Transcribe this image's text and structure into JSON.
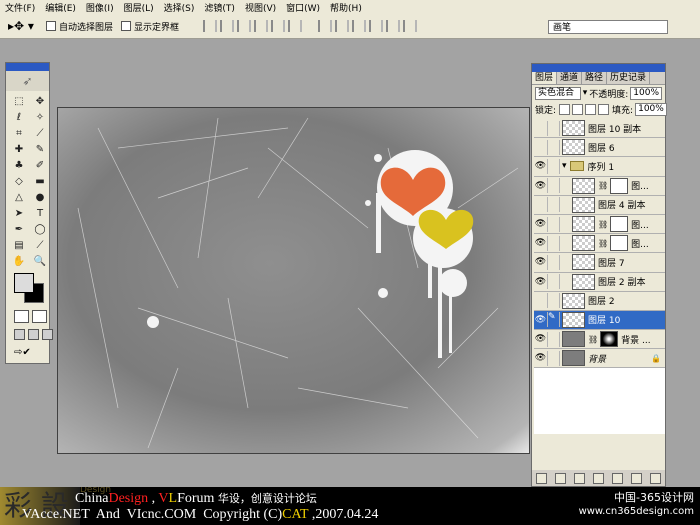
{
  "menu": [
    "文件(F)",
    "编辑(E)",
    "图像(I)",
    "图层(L)",
    "选择(S)",
    "滤镜(T)",
    "视图(V)",
    "窗口(W)",
    "帮助(H)"
  ],
  "options": {
    "tool_icon": "move-tool-icon",
    "auto_select_label": "自动选择图层",
    "show_bounds_label": "显示定界框",
    "brush_tab": "画笔"
  },
  "panel": {
    "tabs": [
      "图层",
      "通道",
      "路径",
      "历史记录"
    ],
    "blend_mode": "实色混合",
    "opacity_label": "不透明度:",
    "opacity_value": "100%",
    "lock_label": "锁定:",
    "fill_label": "填充:",
    "fill_value": "100%"
  },
  "layers": [
    {
      "name": "图层 10 副本",
      "visible": false,
      "type": "layer",
      "indent": 0,
      "selected": false
    },
    {
      "name": "图层 6",
      "visible": false,
      "type": "layer",
      "indent": 0,
      "selected": false
    },
    {
      "name": "序列 1",
      "visible": true,
      "type": "group",
      "indent": 0,
      "selected": false
    },
    {
      "name": "图...",
      "visible": true,
      "type": "masked",
      "indent": 1,
      "selected": false
    },
    {
      "name": "图层 4 副本",
      "visible": false,
      "type": "layer",
      "indent": 1,
      "selected": false
    },
    {
      "name": "图...",
      "visible": true,
      "type": "masked",
      "indent": 1,
      "selected": false
    },
    {
      "name": "图...",
      "visible": true,
      "type": "masked",
      "indent": 1,
      "selected": false
    },
    {
      "name": "图层 7",
      "visible": true,
      "type": "layer",
      "indent": 1,
      "selected": false
    },
    {
      "name": "图层 2 副本",
      "visible": true,
      "type": "layer",
      "indent": 1,
      "selected": false
    },
    {
      "name": "图层 2",
      "visible": false,
      "type": "layer",
      "indent": 0,
      "selected": false
    },
    {
      "name": "图层 10",
      "visible": true,
      "type": "layer",
      "indent": 0,
      "selected": true
    },
    {
      "name": "背景 ...",
      "visible": true,
      "type": "adjust",
      "indent": 0,
      "selected": false
    },
    {
      "name": "背景",
      "visible": true,
      "type": "background",
      "indent": 0,
      "selected": false
    }
  ],
  "banner": {
    "china": "China",
    "design": "Design",
    "sep1": " , ",
    "v": "V",
    "l": "L",
    "forum": "Forum",
    "cn_text": " 华设，创意设计论坛",
    "line2": "VAcce.NET  And  VIcnc.COM  Copyright (C)",
    "cat": "CAT",
    "date": " ,2007.04.24",
    "site_cn": "中国-365设计网",
    "site_url": "www.cn365design.com",
    "tag": "Design"
  }
}
